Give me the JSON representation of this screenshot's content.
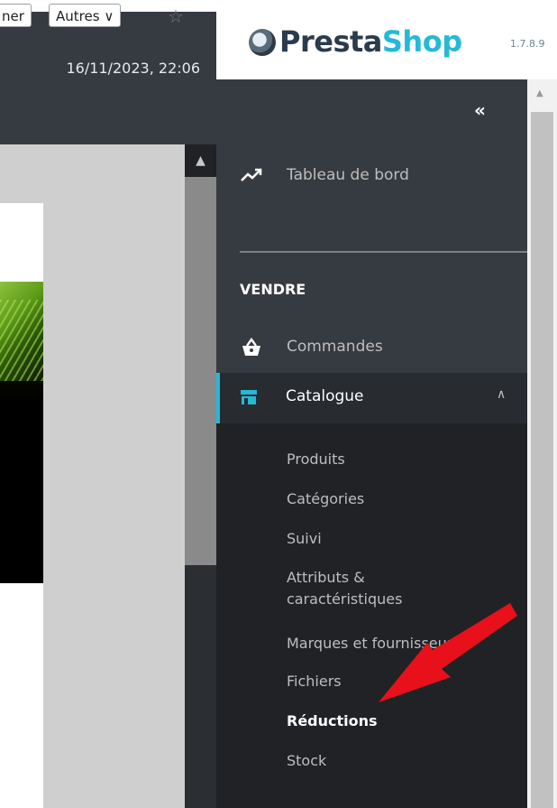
{
  "browser": {
    "tab_partial": "ner",
    "tab_other": "Autres",
    "datetime": "16/11/2023, 22:06"
  },
  "brand": {
    "name_first": "Presta",
    "name_second": "Shop",
    "version": "1.7.8.9"
  },
  "sidebar": {
    "collapse_label": "«",
    "dashboard_label": "Tableau de bord",
    "section_title": "VENDRE",
    "orders_label": "Commandes",
    "catalogue_label": "Catalogue",
    "submenu": [
      {
        "label": "Produits"
      },
      {
        "label": "Catégories"
      },
      {
        "label": "Suivi"
      },
      {
        "label": "Attributs &"
      },
      {
        "label": "caractéristiques"
      },
      {
        "label": "Marques et fournisseurs"
      },
      {
        "label": "Fichiers"
      },
      {
        "label": "Réductions"
      },
      {
        "label": "Stock"
      }
    ]
  },
  "colors": {
    "sidebar_bg": "#363a41",
    "submenu_bg": "#202226",
    "accent": "#25b9d7",
    "annotation_arrow": "#e8101a"
  }
}
